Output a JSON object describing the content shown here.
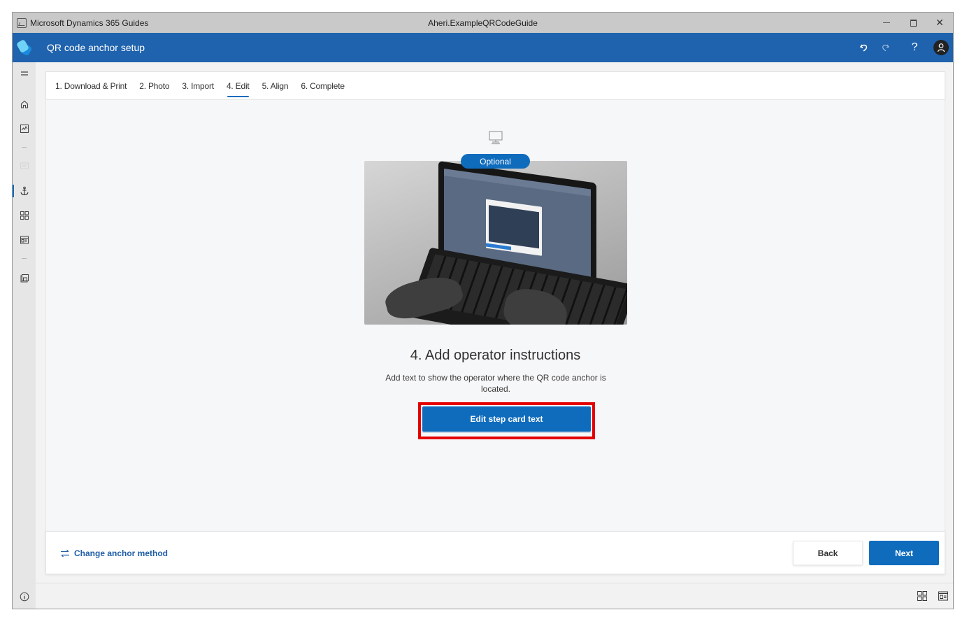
{
  "window": {
    "app_name": "Microsoft Dynamics 365 Guides",
    "document_title": "Aheri.ExampleQRCodeGuide",
    "controls": [
      "minimize",
      "maximize",
      "close"
    ]
  },
  "header": {
    "title": "QR code anchor setup",
    "actions": {
      "undo_icon": "undo-icon",
      "redo_icon": "redo-icon",
      "help_label": "?",
      "account_icon": "person-icon"
    }
  },
  "leftnav": {
    "items": [
      {
        "name": "menu",
        "icon": "hamburger-icon"
      },
      {
        "name": "home",
        "icon": "home-icon"
      },
      {
        "name": "analytics",
        "icon": "chart-icon"
      },
      {
        "name": "step",
        "icon": "card-icon",
        "disabled": true
      },
      {
        "name": "anchor",
        "icon": "anchor-icon",
        "active": true
      },
      {
        "name": "outline",
        "icon": "grid-icon"
      },
      {
        "name": "layout",
        "icon": "layout-icon"
      },
      {
        "name": "save",
        "icon": "save-icon"
      }
    ],
    "info_icon": "info-icon"
  },
  "tabs": [
    {
      "label": "1. Download & Print",
      "active": false
    },
    {
      "label": "2. Photo",
      "active": false
    },
    {
      "label": "3. Import",
      "active": false
    },
    {
      "label": "4. Edit",
      "active": true
    },
    {
      "label": "5. Align",
      "active": false
    },
    {
      "label": "6. Complete",
      "active": false
    }
  ],
  "main": {
    "device_icon": "monitor-icon",
    "badge": "Optional",
    "illustration": "person typing on laptop showing operator instructions dialog",
    "title": "4. Add operator instructions",
    "description": "Add text to show the operator where the QR code anchor is located.",
    "primary_button": "Edit step card text"
  },
  "footer": {
    "change_method_label": "Change anchor method",
    "back_label": "Back",
    "next_label": "Next"
  },
  "statusbar": {
    "icons": [
      "outline-view-icon",
      "card-view-icon"
    ]
  },
  "colors": {
    "header_bg": "#1f62ad",
    "accent": "#0f6cbd",
    "highlight_border": "#e50000",
    "titlebar_bg": "#c9c9c9"
  }
}
